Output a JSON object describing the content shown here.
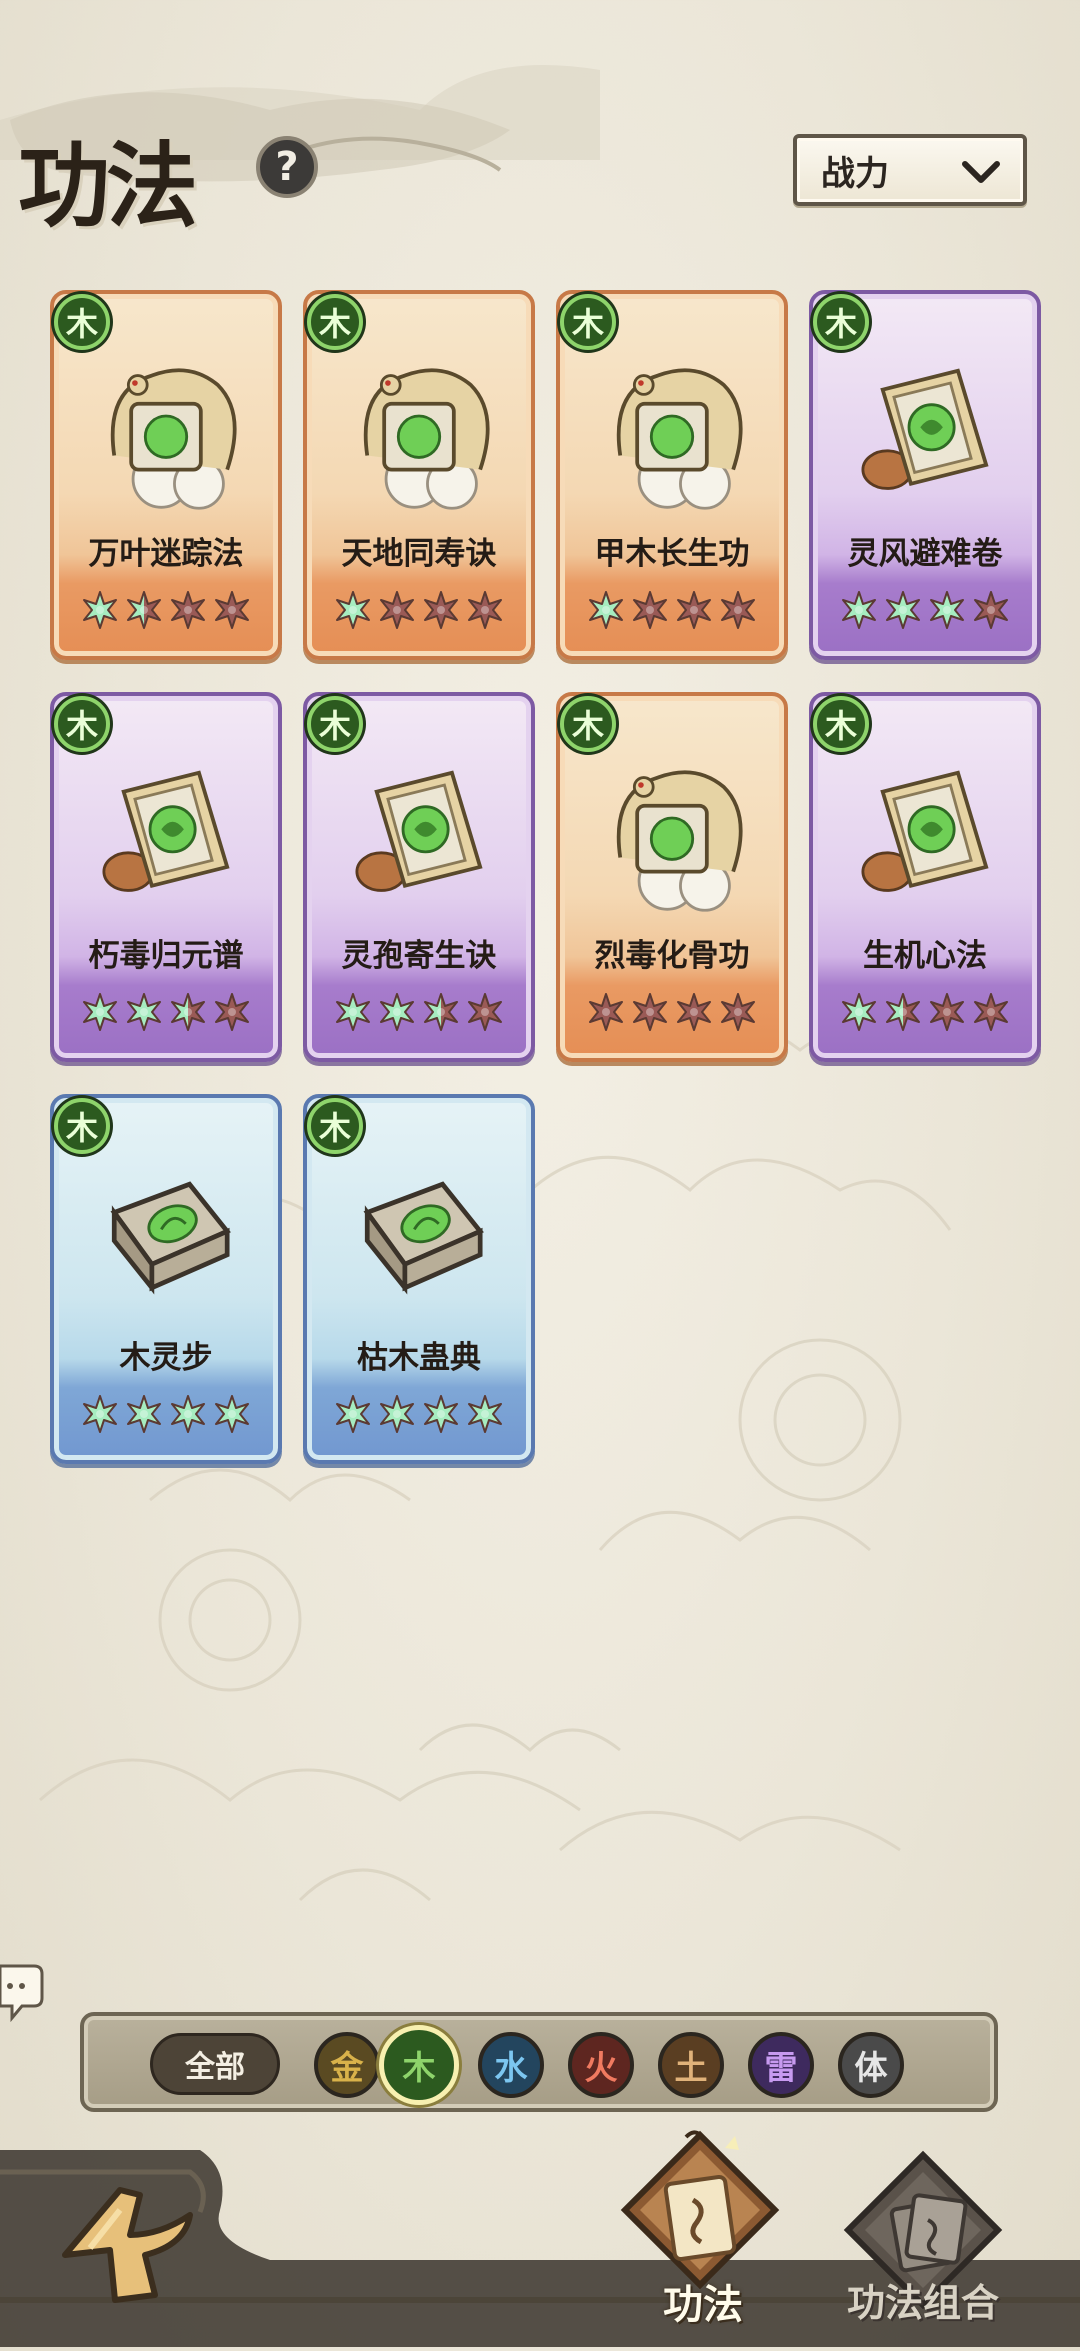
{
  "header": {
    "title": "功法",
    "help_symbol": "?",
    "sort_label": "战力"
  },
  "cards": [
    {
      "element": "木",
      "name": "万叶迷踪法",
      "rarity": "orange",
      "stars_lit": 1.5,
      "stars_total": 4
    },
    {
      "element": "木",
      "name": "天地同寿诀",
      "rarity": "orange",
      "stars_lit": 1,
      "stars_total": 4
    },
    {
      "element": "木",
      "name": "甲木长生功",
      "rarity": "orange",
      "stars_lit": 1,
      "stars_total": 4
    },
    {
      "element": "木",
      "name": "灵风避难卷",
      "rarity": "purple",
      "stars_lit": 3,
      "stars_total": 4
    },
    {
      "element": "木",
      "name": "朽毒归元谱",
      "rarity": "purple",
      "stars_lit": 2.5,
      "stars_total": 4
    },
    {
      "element": "木",
      "name": "灵孢寄生诀",
      "rarity": "purple",
      "stars_lit": 2.5,
      "stars_total": 4
    },
    {
      "element": "木",
      "name": "烈毒化骨功",
      "rarity": "orange",
      "stars_lit": 0,
      "stars_total": 4
    },
    {
      "element": "木",
      "name": "生机心法",
      "rarity": "purple",
      "stars_lit": 1.5,
      "stars_total": 4
    },
    {
      "element": "木",
      "name": "木灵步",
      "rarity": "blue",
      "stars_lit": 4,
      "stars_total": 4
    },
    {
      "element": "木",
      "name": "枯木蛊典",
      "rarity": "blue",
      "stars_lit": 4,
      "stars_total": 4
    }
  ],
  "filter": {
    "all_label": "全部",
    "elements": [
      {
        "label": "金",
        "color": "#d9b24a",
        "bg": "#5a4a22"
      },
      {
        "label": "木",
        "color": "#8ed46b",
        "bg": "#2c5a1f",
        "selected": true
      },
      {
        "label": "水",
        "color": "#7cc6f0",
        "bg": "#23455e"
      },
      {
        "label": "火",
        "color": "#f07a60",
        "bg": "#5e2620"
      },
      {
        "label": "土",
        "color": "#e0b27a",
        "bg": "#5a3e22"
      },
      {
        "label": "雷",
        "color": "#c79af0",
        "bg": "#3e2a5e"
      },
      {
        "label": "体",
        "color": "#e6e6e6",
        "bg": "#4a4a4a"
      }
    ]
  },
  "bottom_tabs": {
    "gongfa": "功法",
    "combo": "功法组合"
  },
  "colors": {
    "star_lit": "#a6ecc0",
    "star_dim": "#9a5a56",
    "wood_green": "#8ed46b"
  }
}
